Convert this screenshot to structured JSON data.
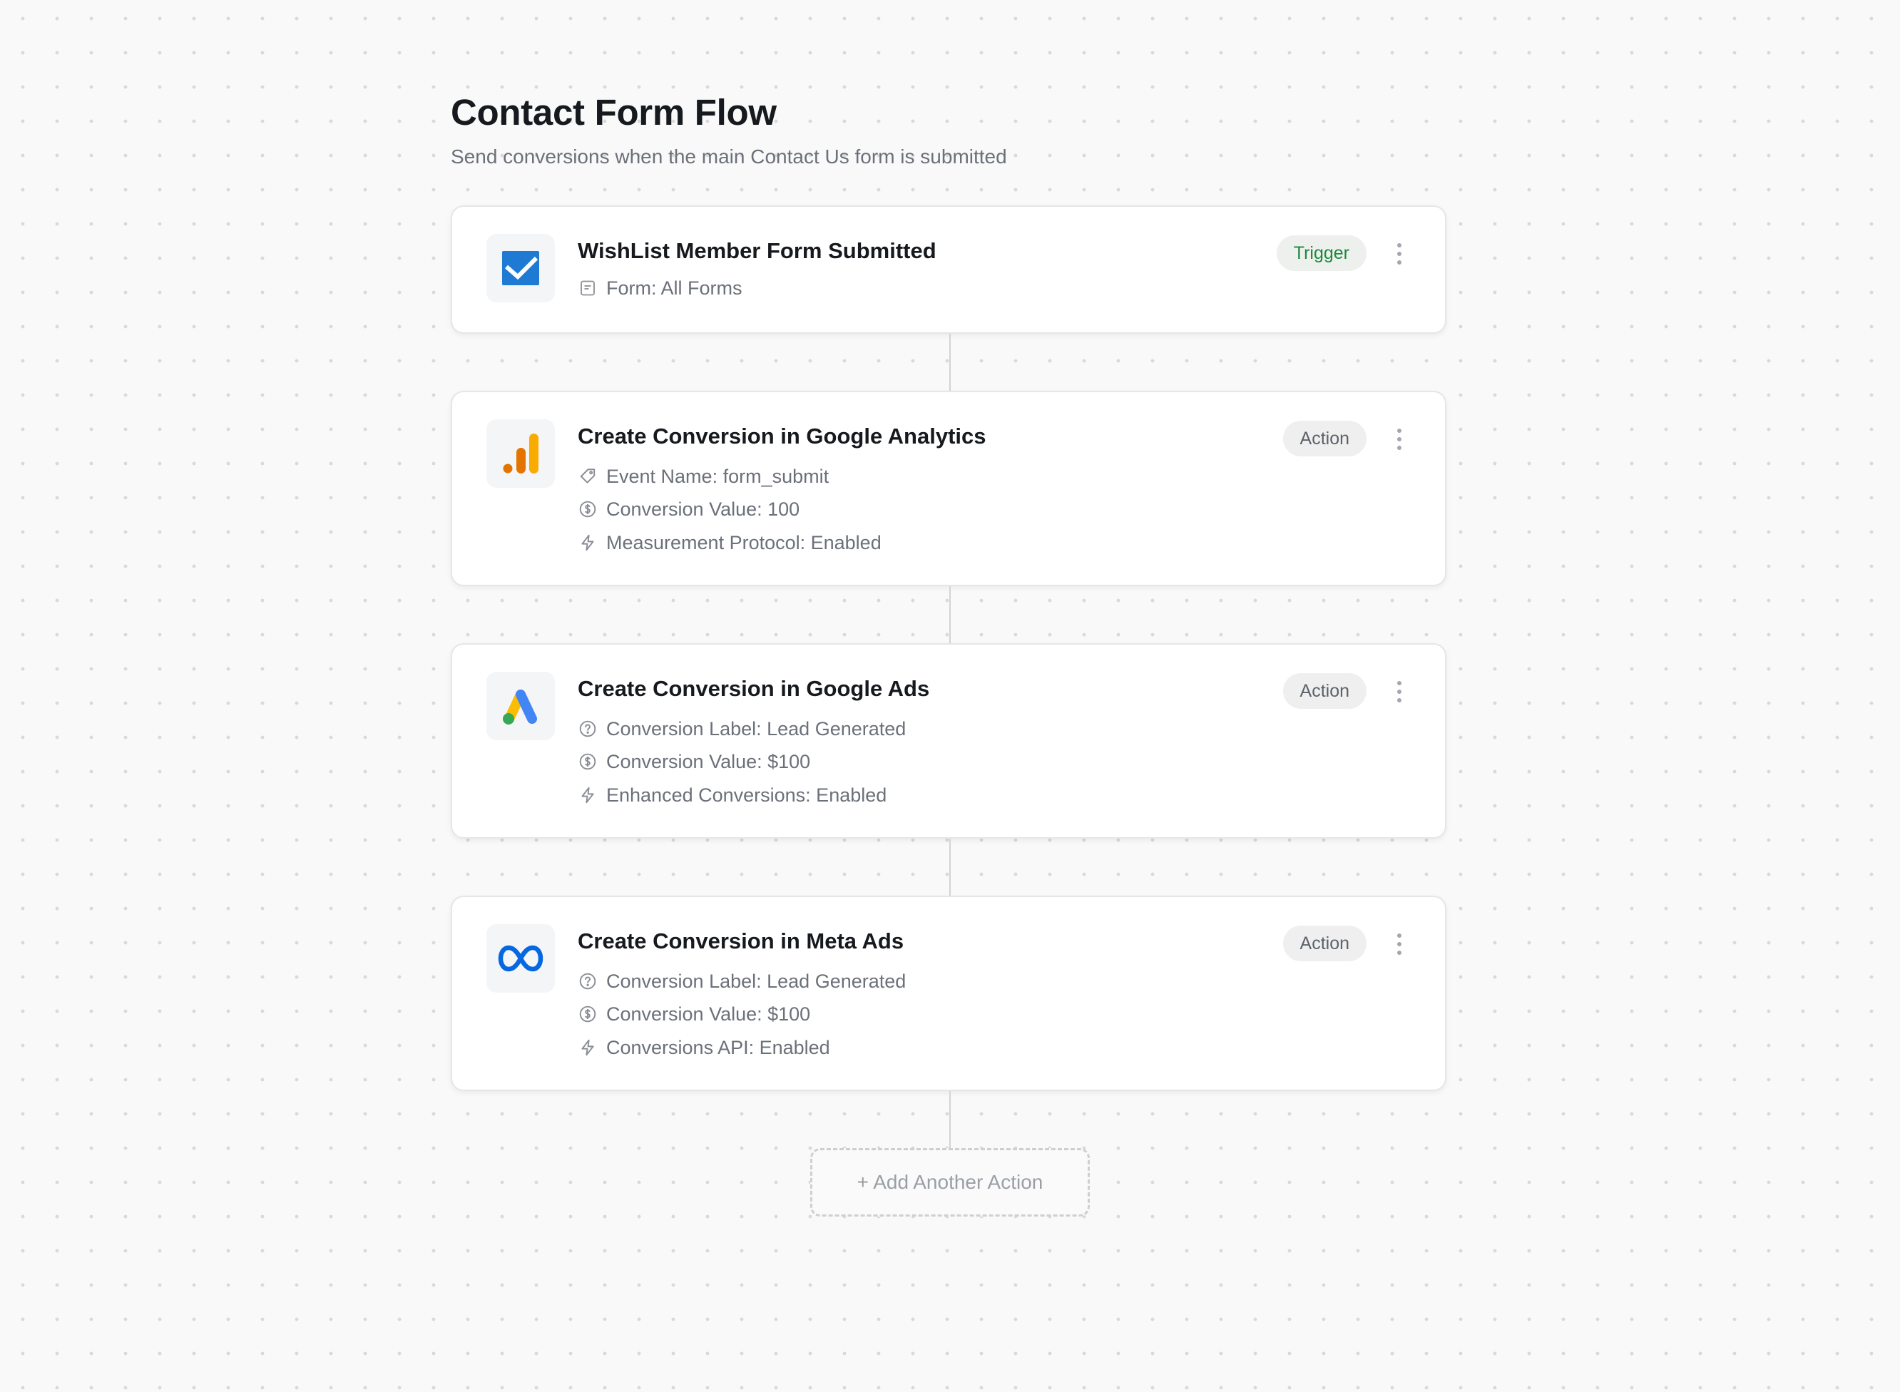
{
  "header": {
    "title": "Contact Form Flow",
    "subtitle": "Send conversions when the main Contact Us form is submitted"
  },
  "steps": [
    {
      "logo_icon": "wishlist-member-logo-icon",
      "title": "WishList Member Form Submitted",
      "badge": "Trigger",
      "details": [
        {
          "icon": "form-icon",
          "text": "Form: All Forms"
        }
      ]
    },
    {
      "logo_icon": "google-analytics-logo-icon",
      "title": "Create Conversion in Google Analytics",
      "badge": "Action",
      "details": [
        {
          "icon": "tag-icon",
          "text": "Event Name: form_submit"
        },
        {
          "icon": "dollar-circle-icon",
          "text": "Conversion Value: 100"
        },
        {
          "icon": "lightning-icon",
          "text": "Measurement Protocol: Enabled"
        }
      ]
    },
    {
      "logo_icon": "google-ads-logo-icon",
      "title": "Create Conversion in Google Ads",
      "badge": "Action",
      "details": [
        {
          "icon": "question-circle-icon",
          "text": "Conversion Label: Lead Generated"
        },
        {
          "icon": "dollar-circle-icon",
          "text": "Conversion Value: $100"
        },
        {
          "icon": "lightning-icon",
          "text": "Enhanced Conversions: Enabled"
        }
      ]
    },
    {
      "logo_icon": "meta-logo-icon",
      "title": "Create Conversion in Meta Ads",
      "badge": "Action",
      "details": [
        {
          "icon": "question-circle-icon",
          "text": "Conversion Label: Lead Generated"
        },
        {
          "icon": "dollar-circle-icon",
          "text": "Conversion Value: $100"
        },
        {
          "icon": "lightning-icon",
          "text": "Conversions API: Enabled"
        }
      ]
    }
  ],
  "add_action_label": "+ Add Another Action",
  "colors": {
    "trigger_badge_text": "#1c8a3c",
    "wishlist_blue": "#1f7ad4",
    "analytics_orange": "#f9ab00",
    "analytics_dark_orange": "#e37400",
    "ads_yellow": "#fbbc04",
    "ads_blue": "#4285f4",
    "ads_green": "#34a853",
    "meta_blue": "#0668e1"
  }
}
